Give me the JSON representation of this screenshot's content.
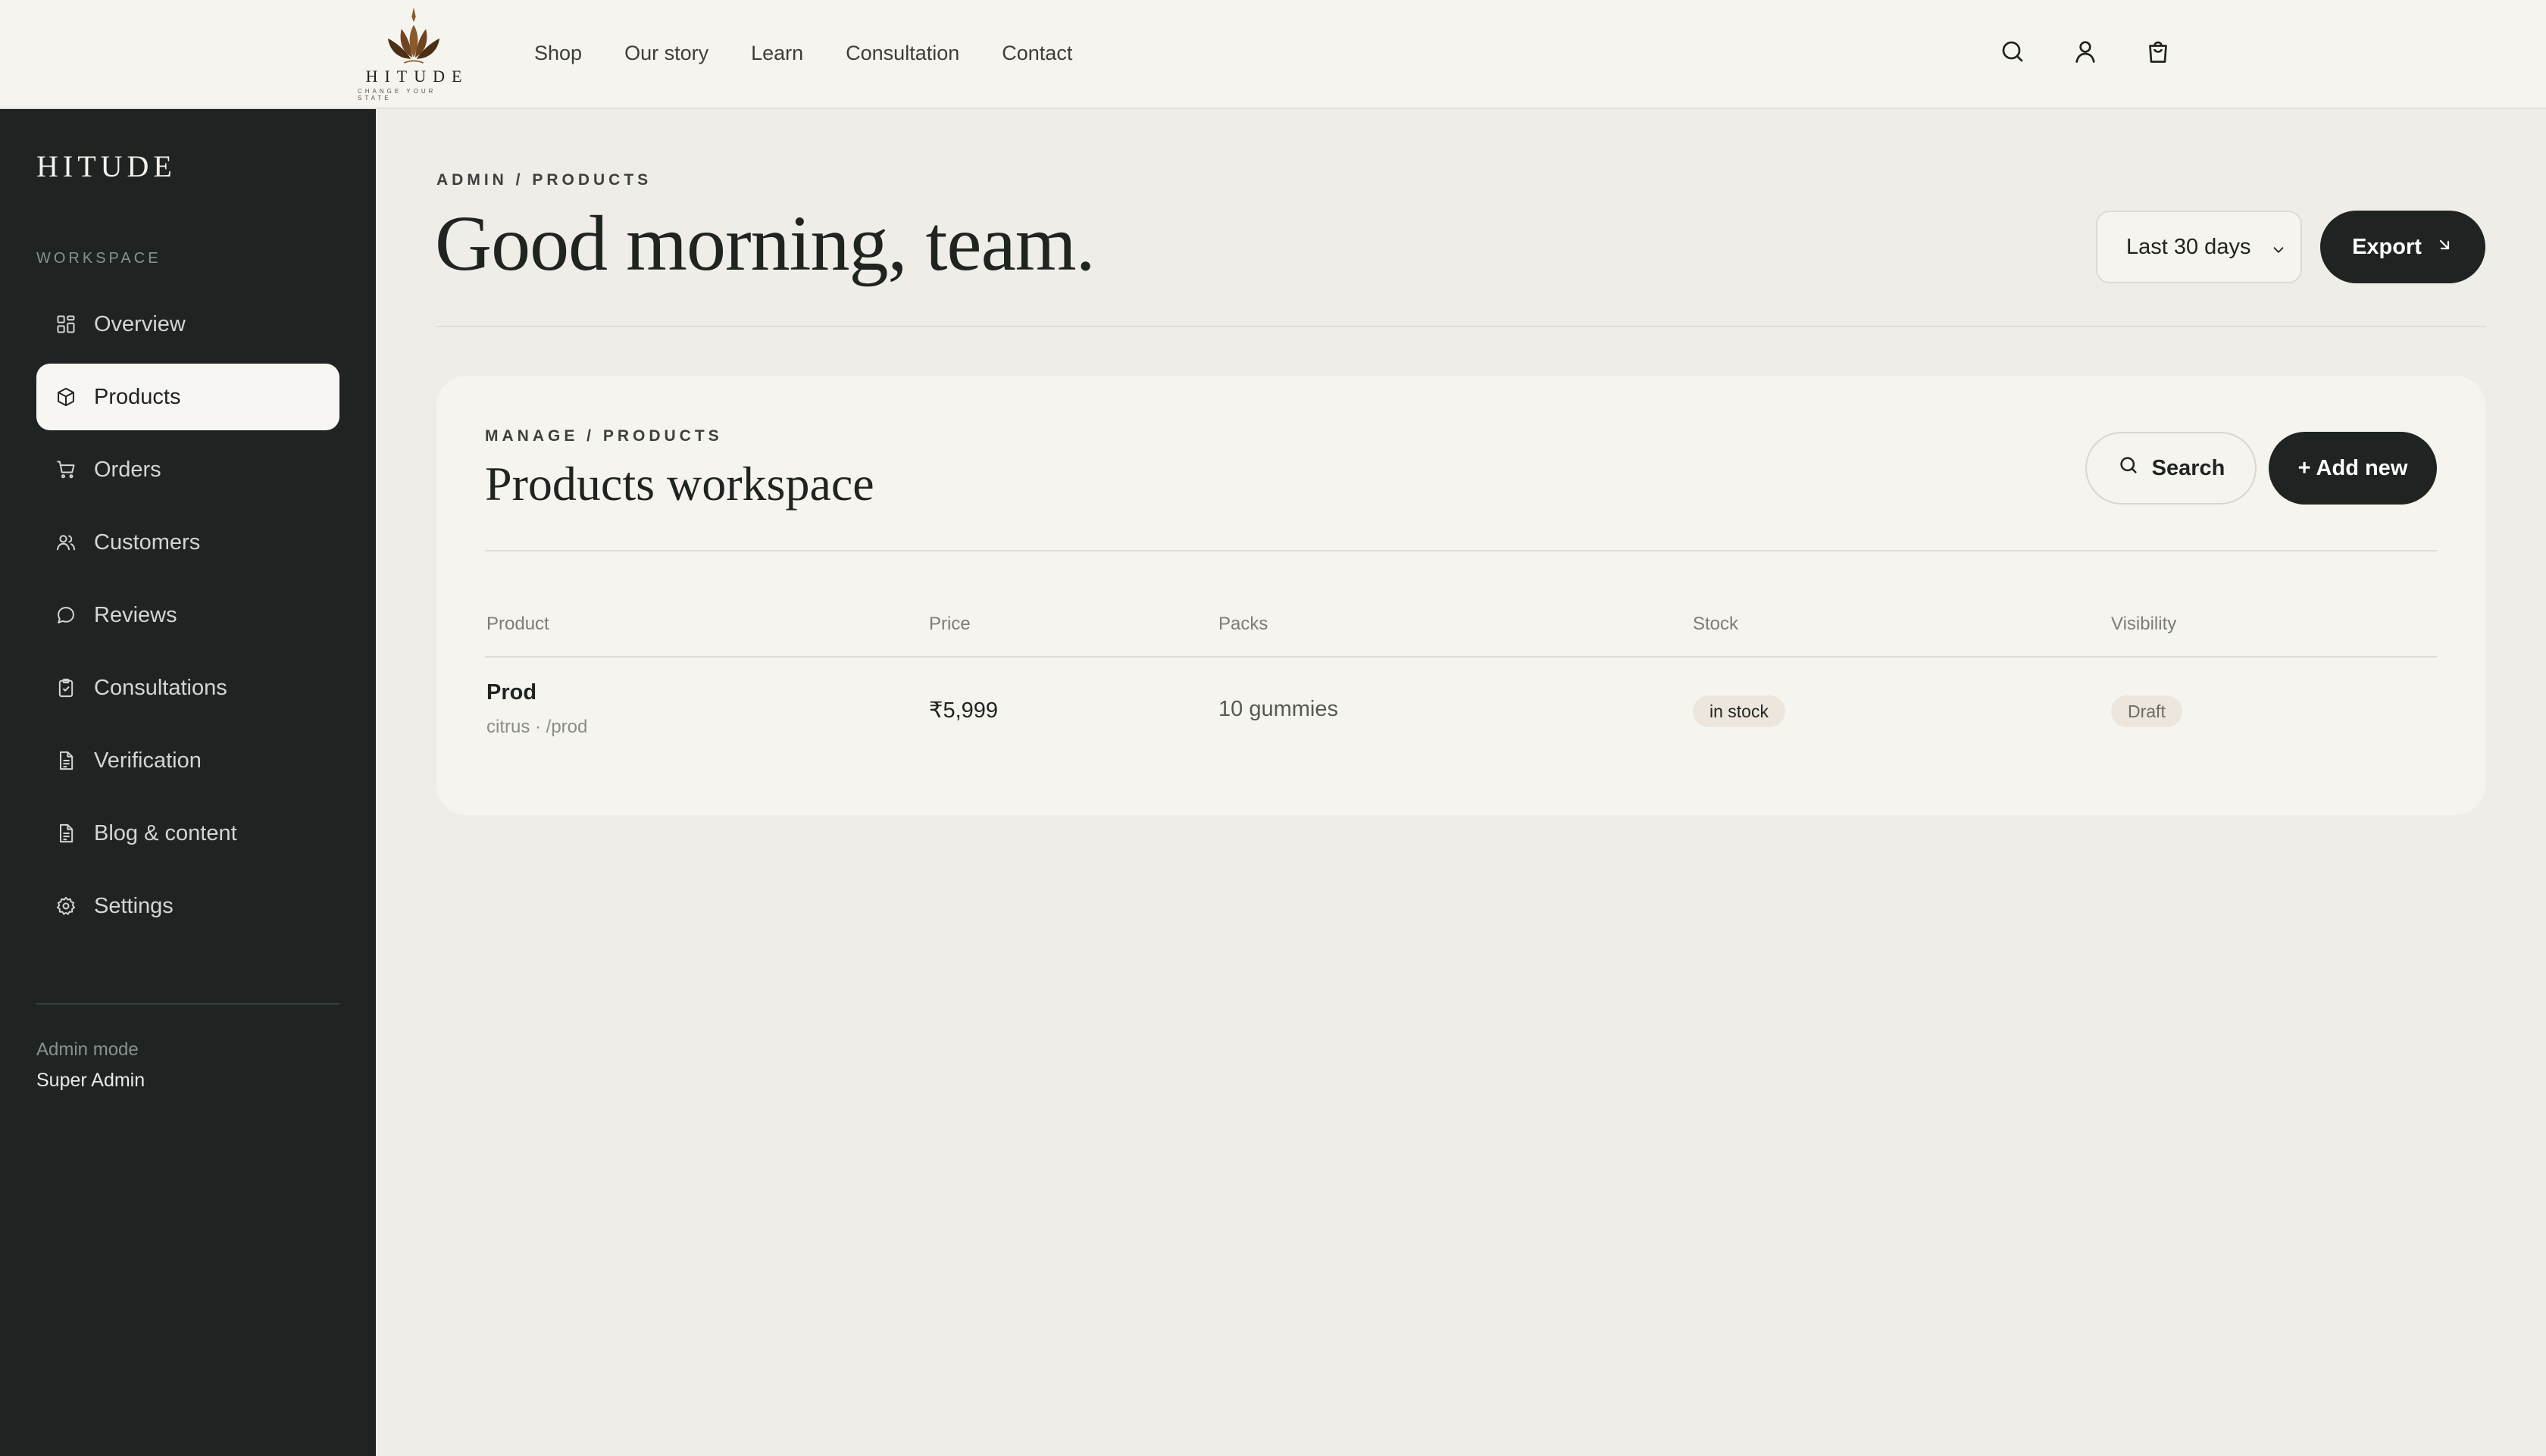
{
  "topnav": {
    "logo": {
      "wordmark": "HITUDE",
      "tagline": "CHANGE YOUR STATE"
    },
    "links": [
      "Shop",
      "Our story",
      "Learn",
      "Consultation",
      "Contact"
    ],
    "icons": [
      "search-icon",
      "user-icon",
      "bag-icon"
    ]
  },
  "sidebar": {
    "brand": "HITUDE",
    "section_label": "WORKSPACE",
    "items": [
      {
        "label": "Overview",
        "icon": "grid-icon"
      },
      {
        "label": "Products",
        "icon": "box-icon",
        "active": true
      },
      {
        "label": "Orders",
        "icon": "cart-icon"
      },
      {
        "label": "Customers",
        "icon": "users-icon"
      },
      {
        "label": "Reviews",
        "icon": "chat-icon"
      },
      {
        "label": "Consultations",
        "icon": "clipboard-icon"
      },
      {
        "label": "Verification",
        "icon": "document-icon"
      },
      {
        "label": "Blog & content",
        "icon": "document-icon"
      },
      {
        "label": "Settings",
        "icon": "gear-icon"
      }
    ],
    "footer": {
      "mode_label": "Admin mode",
      "role": "Super Admin"
    }
  },
  "header": {
    "breadcrumb": "ADMIN / PRODUCTS",
    "greeting": "Good morning, team.",
    "range": "Last 30 days",
    "export_label": "Export"
  },
  "workspace": {
    "breadcrumb": "MANAGE / PRODUCTS",
    "title": "Products workspace",
    "search_label": "Search",
    "add_label": "+ Add new",
    "columns": [
      "Product",
      "Price",
      "Packs",
      "Stock",
      "Visibility"
    ],
    "rows": [
      {
        "name": "Prod",
        "meta": "citrus · /prod",
        "price": "₹5,999",
        "packs": "10 gummies",
        "stock": "in stock",
        "visibility": "Draft"
      }
    ]
  },
  "colors": {
    "sidebar_bg": "#1f2423",
    "page_bg": "#efede8",
    "card_bg": "#f6f4ef",
    "accent_dark": "#1f2423",
    "logo_bronze": "#8a5a2b"
  }
}
